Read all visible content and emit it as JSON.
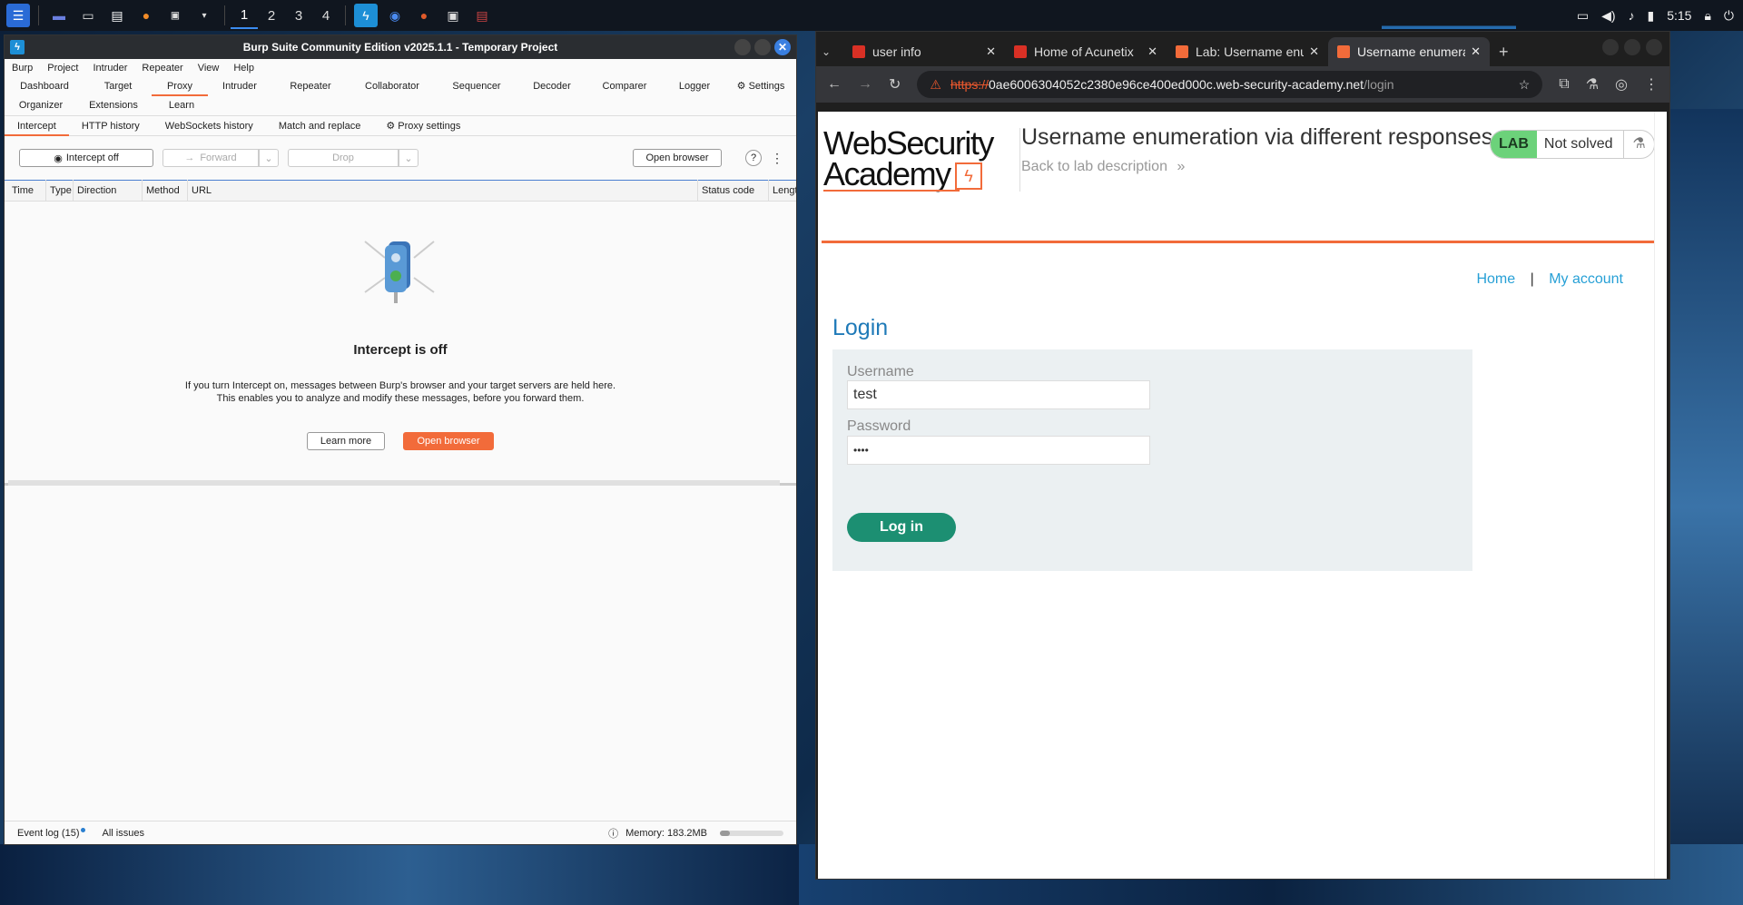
{
  "taskbar": {
    "workspaces": [
      "1",
      "2",
      "3",
      "4"
    ],
    "clock": "5:15",
    "icons": [
      "kali-menu-icon",
      "desktop-icon",
      "file-manager-icon",
      "text-editor-icon",
      "firefox-icon",
      "terminal-icon",
      "burp-icon",
      "chromium-icon",
      "firefox-icon",
      "terminal-icon",
      "script-icon"
    ]
  },
  "burp": {
    "title": "Burp Suite Community Edition v2025.1.1 - Temporary Project",
    "menu": [
      "Burp",
      "Project",
      "Intruder",
      "Repeater",
      "View",
      "Help"
    ],
    "tabs": [
      "Dashboard",
      "Target",
      "Proxy",
      "Intruder",
      "Repeater",
      "Collaborator",
      "Sequencer",
      "Decoder",
      "Comparer",
      "Logger",
      "Settings",
      "Organizer",
      "Extensions",
      "Learn"
    ],
    "subtabs": [
      "Intercept",
      "HTTP history",
      "WebSockets history",
      "Match and replace",
      "Proxy settings"
    ],
    "toolbar": {
      "intercept": "Intercept off",
      "forward": "Forward",
      "drop": "Drop",
      "open_browser": "Open browser",
      "help": "?",
      "more": "⋮"
    },
    "columns": [
      "Time",
      "Type",
      "Direction",
      "Method",
      "URL",
      "Status code",
      "Lengt"
    ],
    "empty": {
      "title": "Intercept is off",
      "line1": "If you turn Intercept on, messages between Burp's browser and your target servers are held here.",
      "line2": "This enables you to analyze and modify these messages, before you forward them.",
      "learn_more": "Learn more",
      "open_browser": "Open browser"
    },
    "status": {
      "event_log": "Event log (15)",
      "all_issues": "All issues",
      "memory": "Memory: 183.2MB",
      "memory_fraction": 0.15
    }
  },
  "chrome": {
    "tabs": [
      {
        "title": "user info",
        "color": "#d93025"
      },
      {
        "title": "Home of Acunetix",
        "color": "#d93025"
      },
      {
        "title": "Lab: Username enumeration",
        "color": "#f26b3a"
      },
      {
        "title": "Username enumeration",
        "color": "#f26b3a"
      }
    ],
    "new_tab": "+",
    "url": {
      "scheme": "https://",
      "host": "0ae6006304052c2380e96ce400ed000c.web-security-academy.net",
      "path": "/login"
    }
  },
  "page": {
    "logo_line1": "WebSecurity",
    "logo_line2": "Academy",
    "logo_bolt": "ϟ",
    "lab_title": "Username enumeration via different responses",
    "back_link": "Back to lab description",
    "back_arrow": "»",
    "lab_badge": "LAB",
    "lab_status": "Not solved",
    "flask": "⚗",
    "nav_home": "Home",
    "nav_sep": "|",
    "nav_account": "My account",
    "heading": "Login",
    "username_label": "Username",
    "username_value": "test",
    "password_label": "Password",
    "password_value": "••••",
    "login_button": "Log in"
  },
  "colors": {
    "accent": "#f26b3a",
    "link": "#27a0d6",
    "login_button": "#1c8f72",
    "lab_green": "#6cd27a"
  }
}
